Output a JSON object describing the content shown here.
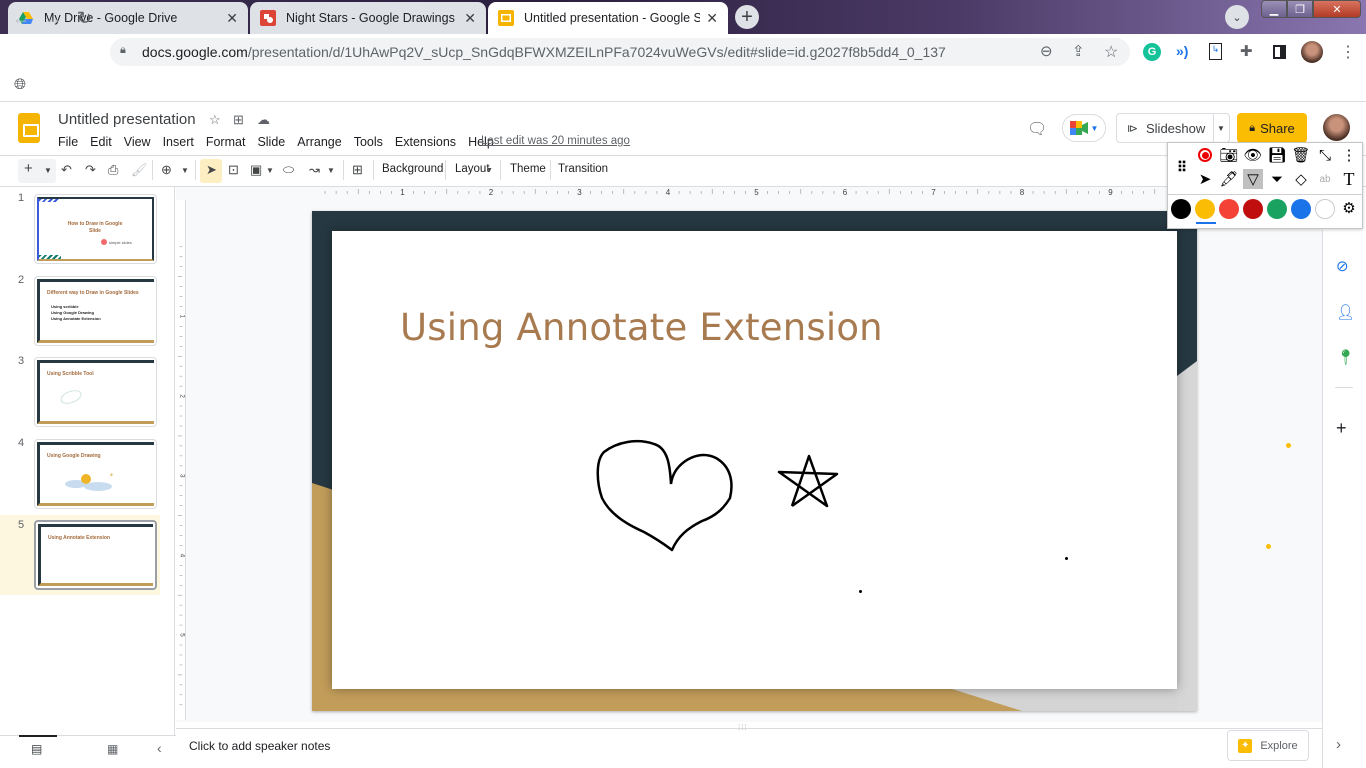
{
  "browser": {
    "tabs": [
      {
        "title": "My Drive - Google Drive",
        "icon": "google-drive-icon",
        "active": false
      },
      {
        "title": "Night Stars - Google Drawings",
        "icon": "google-drawings-icon",
        "active": false
      },
      {
        "title": "Untitled presentation - Google Sli",
        "icon": "google-slides-icon",
        "active": true
      }
    ],
    "url_host": "docs.google.com",
    "url_path": "/presentation/d/1UhAwPq2V_sUcp_SnGdqBFWXMZEILnPFa7024vuWeGVs/edit#slide=id.g2027f8b5dd4_0_137"
  },
  "doc": {
    "title": "Untitled presentation",
    "menu": [
      "File",
      "Edit",
      "View",
      "Insert",
      "Format",
      "Slide",
      "Arrange",
      "Tools",
      "Extensions",
      "Help"
    ],
    "last_edit": "Last edit was 20 minutes ago",
    "slideshow_label": "Slideshow",
    "share_label": "Share"
  },
  "toolbar": {
    "background_label": "Background",
    "layout_label": "Layout",
    "theme_label": "Theme",
    "transition_label": "Transition"
  },
  "ruler": {
    "h_labels": [
      "1",
      "2",
      "3",
      "4",
      "5",
      "6",
      "7",
      "8",
      "9"
    ],
    "v_labels": [
      "1",
      "2",
      "3",
      "4",
      "5"
    ]
  },
  "filmstrip": {
    "slides": [
      {
        "num": "1",
        "title": "How to Draw in Google Slide",
        "sub": "simple slides"
      },
      {
        "num": "2",
        "title": "Different way to Draw in Google Slides",
        "bullets": [
          "Using scribble",
          "Using Google Drawing",
          "Using Annotate Extension"
        ]
      },
      {
        "num": "3",
        "title": "Using Scribble Tool"
      },
      {
        "num": "4",
        "title": "Using Google Drawing"
      },
      {
        "num": "5",
        "title": "Using Annotate Extension",
        "selected": true
      }
    ]
  },
  "slide": {
    "title": "Using Annotate Extension",
    "accent_color": "#a87a50",
    "frame_dark": "#263842",
    "frame_gold": "#c29d5a"
  },
  "notes": {
    "placeholder": "Click to add speaker notes"
  },
  "explore_label": "Explore",
  "annotate": {
    "top_tools": [
      "record-icon",
      "camera-icon",
      "eye-icon",
      "save-icon",
      "trash-icon",
      "collapse-icon",
      "more-icon"
    ],
    "bottom_tools": [
      "pointer-icon",
      "marker-icon",
      "pen-icon",
      "highlighter-icon",
      "eraser-icon",
      "text-style-icon",
      "text-icon"
    ],
    "colors": [
      "#000000",
      "#fbbc04",
      "#f44336",
      "#c00d0d",
      "#1aa260",
      "#1a73e8",
      "#ffffff"
    ],
    "selected_color": "#fbbc04",
    "selected_tool": "pen-icon"
  }
}
